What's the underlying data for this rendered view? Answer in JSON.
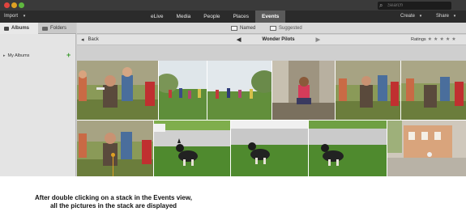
{
  "window": {
    "search_placeholder": "Search"
  },
  "menubar": {
    "import_label": "Import",
    "tabs": [
      "eLive",
      "Media",
      "People",
      "Places",
      "Events"
    ],
    "active_tab": "Events",
    "create_label": "Create",
    "share_label": "Share"
  },
  "sidebar": {
    "albums_tab": "Albums",
    "folders_tab": "Folders",
    "my_albums": "My Albums"
  },
  "subbar": {
    "named_label": "Named",
    "suggested_label": "Suggested"
  },
  "navbar": {
    "back_label": "Back",
    "stack_title": "Wonder Pilots",
    "ratings_label": "Ratings",
    "stars": 5
  },
  "photos": [
    {
      "subject": "boys-with-toy-plane"
    },
    {
      "subject": "kids-in-park"
    },
    {
      "subject": "kids-in-park"
    },
    {
      "subject": "girl-on-steps"
    },
    {
      "subject": "boys-with-toy-plane"
    },
    {
      "subject": "boys-with-toy-plane"
    },
    {
      "subject": "boys-with-toy-plane"
    },
    {
      "subject": "dog-on-grass"
    },
    {
      "subject": "dog-on-grass"
    },
    {
      "subject": "dog-on-grass"
    },
    {
      "subject": "house-with-bird"
    }
  ],
  "caption": {
    "line1": "After double clicking on a stack in the Events view,",
    "line2": "all the pictures in the stack are displayed"
  },
  "colors": {
    "accent_caption_pointer": "#e0a022",
    "add_button": "#3c9a2f"
  }
}
